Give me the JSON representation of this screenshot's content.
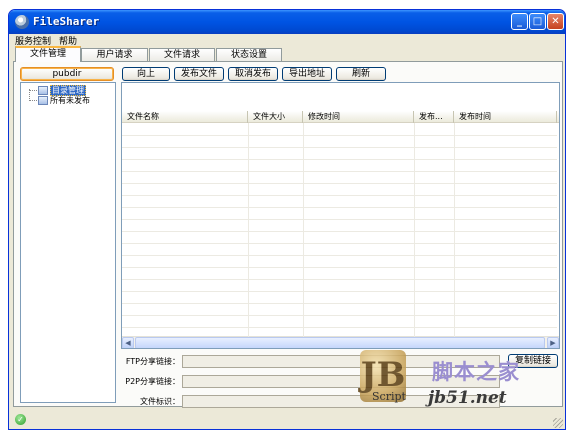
{
  "window": {
    "title": "FileSharer",
    "minimize_glyph": "_",
    "maximize_glyph": "□",
    "close_glyph": "✕",
    "app_icon": "filesharer-logo-icon"
  },
  "menu": {
    "items": [
      "服务控制",
      "帮助"
    ]
  },
  "tabs": [
    {
      "label": "文件管理",
      "active": true
    },
    {
      "label": "用户请求",
      "active": false
    },
    {
      "label": "文件请求",
      "active": false
    },
    {
      "label": "状态设置",
      "active": false
    }
  ],
  "dir_button": "pubdir",
  "toolbar": {
    "up": "向上",
    "publish": "发布文件",
    "unpublish": "取消发布",
    "export": "导出地址",
    "refresh": "刷新"
  },
  "tree": {
    "items": [
      {
        "label": "目录管理",
        "selected": true
      },
      {
        "label": "所有未发布",
        "selected": false
      }
    ]
  },
  "table": {
    "columns": [
      "文件名称",
      "文件大小",
      "修改时间",
      "发布...",
      "发布时间"
    ],
    "rows": []
  },
  "form": {
    "ftp_label": "FTP分享链接：",
    "ftp_value": "",
    "p2p_label": "P2P分享链接：",
    "p2p_value": "",
    "id_label": "文件标识：",
    "id_value": "",
    "copy_button": "复制链接"
  },
  "watermark": {
    "logo_text": "JB",
    "script_text": "Script",
    "cn_text": "脚本之家",
    "url_text": "jb51.net"
  },
  "status": {
    "icon": "check-ok-icon",
    "color": "#2f9e2a"
  },
  "colors": {
    "titlebar": "#0054e3",
    "selection": "#316ac5",
    "window_bg": "#ece9d8"
  }
}
